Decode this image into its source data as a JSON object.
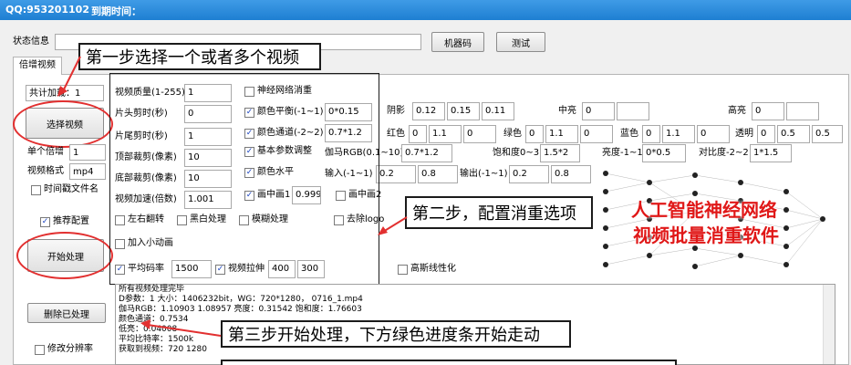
{
  "titlebar": {
    "qq": "QQ:953201102",
    "expire": "到期时间："
  },
  "status": {
    "label": "状态信息",
    "machine_code": "机器码",
    "test": "测试"
  },
  "tab": {
    "label": "倍增视频"
  },
  "left": {
    "total_label": "共计加载：1",
    "select_video": "选择视频",
    "single_mult_label": "单个倍增",
    "single_mult_value": "1",
    "format_label": "视频格式",
    "format_value": "mp4",
    "timestamp_name": "时间戳文件名",
    "recommended": "推荐配置",
    "start": "开始处理",
    "delete_processed": "删除已处理",
    "modify_resolution": "修改分辨率"
  },
  "params": {
    "quality_label": "视频质量(1-255)",
    "quality_value": "1",
    "head_trim_label": "片头剪时(秒)",
    "head_trim_value": "0",
    "tail_trim_label": "片尾剪时(秒)",
    "tail_trim_value": "1",
    "top_crop_label": "顶部裁剪(像素)",
    "top_crop_value": "10",
    "bottom_crop_label": "底部裁剪(像素)",
    "bottom_crop_value": "10",
    "speed_label": "视频加速(倍数)",
    "speed_value": "1.001"
  },
  "checks": {
    "neural": "神经网络消重",
    "color_balance": "颜色平衡(-1~1)",
    "color_balance_value": "0*0.15",
    "color_channel": "颜色通道(-2~2)",
    "color_channel_value": "0.7*1.2",
    "basic_param": "基本参数调整",
    "color_horizontal": "颜色水平",
    "pip1": "画中画1",
    "pip1_value": "0.999",
    "pip2": "画中画2",
    "lr_flip": "左右翻转",
    "bw": "黑白处理",
    "blur": "模糊处理",
    "remove_logo": "去除logo",
    "small_anim": "加入小动画",
    "avg_bitrate": "平均码率",
    "avg_bitrate_value": "1500",
    "stretch": "视频拉伸",
    "stretch_w": "400",
    "stretch_h": "300",
    "hq_linear": "高斯线性化"
  },
  "right": {
    "shadow_label": "阴影",
    "shadow": [
      "0.12",
      "0.15",
      "0.11"
    ],
    "mid_label": "中亮",
    "mid": "0",
    "high_label": "高亮",
    "high": "0",
    "red_label": "红色",
    "red": "0",
    "green_label": "绿色",
    "green": "0",
    "blue_label": "蓝色",
    "blue": "0",
    "transp_label": "透明",
    "transp": "0",
    "rgb_vals": [
      "1.1",
      "0",
      "1.1",
      "0",
      "1.1",
      "0",
      "0.5"
    ],
    "gamma_label": "伽马RGB(0.1~10)",
    "gamma": "0.7*1.2",
    "sat_label": "饱和度0~3",
    "sat": "1.5*2",
    "bright_label": "亮度-1~1",
    "bright": "0*0.5",
    "contrast_label": "对比度-2~2",
    "contrast": "1*1.5",
    "in_label": "输入(-1~1)",
    "in_vals": [
      "0.2",
      "0.8"
    ],
    "out_label": "输出(-1~1)",
    "out_vals": [
      "0.2",
      "0.8"
    ]
  },
  "banner": {
    "line1": "人工智能神经网络",
    "line2": "视频批量消重软件"
  },
  "callouts": {
    "step1": "第一步选择一个或者多个视频",
    "step2": "第二步，配置消重选项",
    "step3": "第三步开始处理，下方绿色进度条开始走动"
  },
  "log": [
    "所有视频处理完毕",
    "D参数：1  大小：1406232bit，WG：720*1280，  0716_1.mp4",
    "伽马RGB：1.10903 1.08957 亮度：0.31542 饱和度：1.76603",
    "颜色通道：0.7534",
    "低亮：0.04008",
    "平均比特率：1500k",
    "获取到视频：720  1280"
  ]
}
